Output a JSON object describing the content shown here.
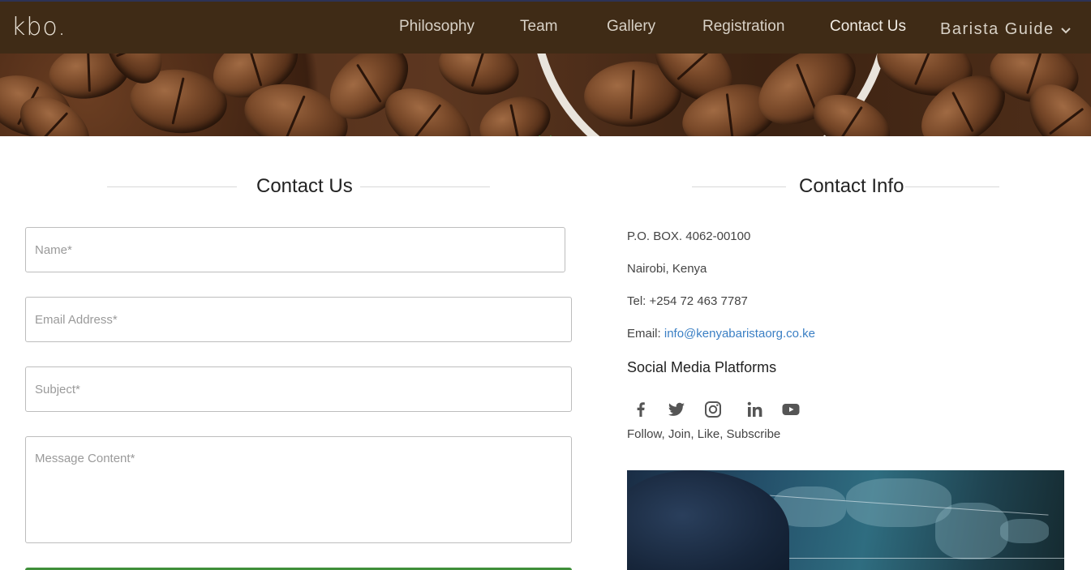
{
  "nav": {
    "logo": "kbo.",
    "items": [
      {
        "label": "Philosophy"
      },
      {
        "label": "Team"
      },
      {
        "label": "Gallery"
      },
      {
        "label": "Registration"
      },
      {
        "label": "Contact Us"
      }
    ],
    "dropdown_label": "Barista Guide"
  },
  "contact_form": {
    "title": "Contact Us",
    "name_placeholder": "Name*",
    "email_placeholder": "Email Address*",
    "subject_placeholder": "Subject*",
    "message_placeholder": "Message Content*"
  },
  "contact_info": {
    "title": "Contact Info",
    "po_box": "P.O. BOX. 4062-00100",
    "city": "Nairobi, Kenya",
    "tel": "Tel: +254 72 463 7787",
    "email_label": "Email:",
    "email_value": "info@kenyabaristaorg.co.ke",
    "social_title": "Social Media Platforms",
    "social_icons": [
      "facebook-icon",
      "twitter-icon",
      "instagram-icon",
      "linkedin-icon",
      "youtube-icon"
    ],
    "social_caption": "Follow, Join, Like, Subscribe"
  },
  "colors": {
    "navbar": "#3f2b16",
    "link": "#3a7fc4",
    "submit": "#3f8f3a",
    "scroll_chevron": "#3fae49"
  }
}
